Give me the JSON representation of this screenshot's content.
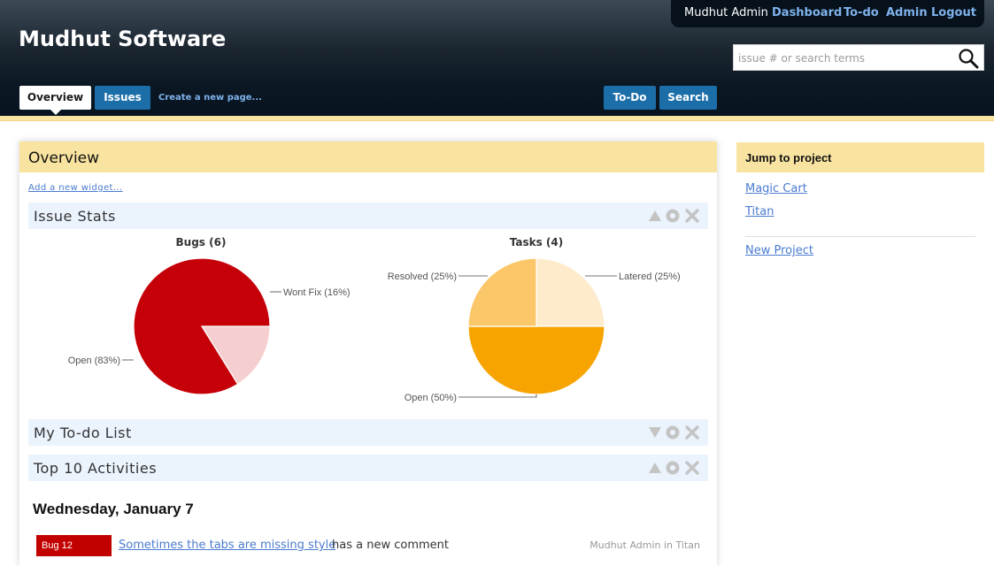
{
  "header": {
    "brand": "Mudhut Software",
    "user_name": "Mudhut Admin",
    "links": [
      "Dashboard",
      "To-do",
      "Admin",
      "Logout"
    ],
    "search_placeholder": "issue # or search terms"
  },
  "nav": {
    "tabs": [
      "Overview",
      "Issues"
    ],
    "create_link": "Create a new page...",
    "buttons": [
      "To-Do",
      "Search"
    ]
  },
  "main": {
    "title": "Overview",
    "add_widget": "Add a new widget...",
    "widgets": [
      "Issue Stats",
      "My To-do List",
      "Top 10 Activities"
    ]
  },
  "chart_data": [
    {
      "type": "pie",
      "title": "Bugs (6)",
      "labels": [
        "Wont Fix (16%)",
        "Open (83%)"
      ],
      "values": [
        16,
        83
      ],
      "colors": [
        "#f5cfd0",
        "#c50008"
      ]
    },
    {
      "type": "pie",
      "title": "Tasks (4)",
      "labels": [
        "Latered (25%)",
        "Open (50%)",
        "Resolved (25%)"
      ],
      "values": [
        25,
        50,
        25
      ],
      "colors": [
        "#fdebcb",
        "#f7a400",
        "#fcc768"
      ]
    }
  ],
  "activities": {
    "date": "Wednesday, January 7",
    "items": [
      {
        "badge": "Bug 12",
        "link": "Sometimes the tabs are missing style",
        "text": "has a new comment",
        "meta": "Mudhut Admin in Titan"
      }
    ]
  },
  "sidebar": {
    "title": "Jump to project",
    "projects": [
      "Magic Cart",
      "Titan"
    ],
    "new_project": "New Project"
  }
}
